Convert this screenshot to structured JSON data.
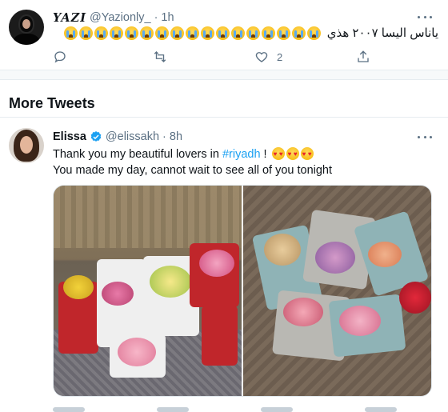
{
  "top_tweet": {
    "display_name": "YAZI",
    "handle": "@Yazionly_",
    "separator": "·",
    "time": "1h",
    "text": "ياناس اليسا ٢٠٠٧ هذي",
    "emoji_count": 17,
    "actions": {
      "reply_count": "",
      "retweet_count": "",
      "like_count": "2",
      "share_count": ""
    }
  },
  "section": {
    "title": "More Tweets"
  },
  "elissa_tweet": {
    "display_name": "Elissa",
    "handle": "@elissakh",
    "separator": "·",
    "time": "8h",
    "line1_text": "Thank you my beautiful lovers in ",
    "hashtag": "#riyadh",
    "line1_suffix": " !",
    "line2_text": "You made my day, cannot wait to see all of you tonight"
  },
  "colors": {
    "accent": "#1da1f2",
    "secondary_text": "#5b7083",
    "border": "#e6ecf0"
  },
  "icons": {
    "reply": "reply-icon",
    "retweet": "retweet-icon",
    "like": "heart-icon",
    "share": "share-icon",
    "more": "more-icon",
    "verified": "verified-badge-icon"
  }
}
